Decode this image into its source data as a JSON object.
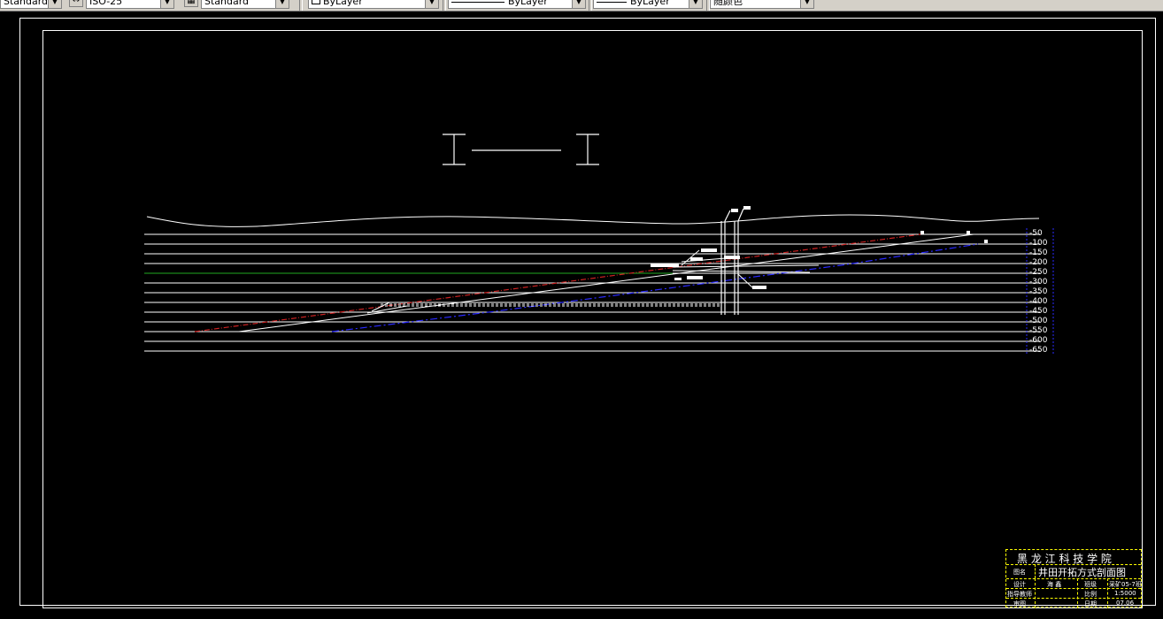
{
  "toolbar": {
    "text_style": "Standard",
    "dim_style": "ISO-25",
    "table_style": "Standard",
    "layer": "ByLayer",
    "linetype": "ByLayer",
    "lineweight": "ByLayer",
    "plot_style": "随颜色"
  },
  "depth_labels": [
    "-50",
    "-100",
    "-150",
    "-200",
    "-250",
    "-300",
    "-350",
    "-400",
    "-450",
    "-500",
    "-550",
    "-600",
    "-650"
  ],
  "title_block": {
    "school": "黑 龙 江 科 技 学 院",
    "name_label": "图名",
    "drawing_name": "井田开拓方式剖面图",
    "design_label": "设计",
    "designer": "海 鑫",
    "class_label": "班级",
    "class_value": "采矿05-7班",
    "advisor_label": "指导教师",
    "scale_label": "比例",
    "scale_value": "1:5000",
    "review_label": "审图",
    "date_label": "日期",
    "date_value": "07.06"
  },
  "colors": {
    "background": "#000000",
    "line": "#ffffff",
    "coal_seam_red": "#cc2222",
    "coal_seam_blue": "#2a2aff",
    "green_level": "#22aa22",
    "title_border": "#ffff00"
  }
}
